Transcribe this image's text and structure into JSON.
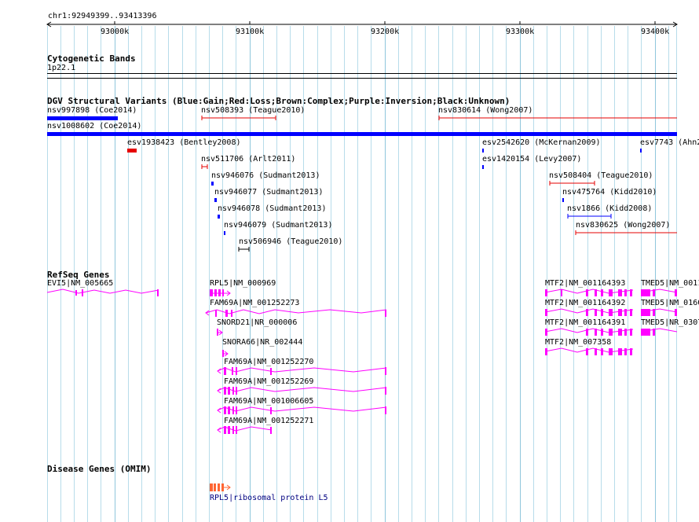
{
  "ruler": {
    "location": "chr1:92949399..93413396",
    "ticks": [
      "93000k",
      "93100k",
      "93200k",
      "93300k",
      "93400k"
    ]
  },
  "cytoband": {
    "title": "Cytogenetic Bands",
    "band": "1p22.1"
  },
  "dgv": {
    "title": "DGV Structural Variants (Blue:Gain;Red:Loss;Brown:Complex;Purple:Inversion;Black:Unknown)",
    "features": [
      {
        "label": "nsv997898 (Coe2014)",
        "color": "#0000ff"
      },
      {
        "label": "nsv508393 (Teague2010)",
        "color": "#e60000"
      },
      {
        "label": "nsv830614 (Wong2007)",
        "color": "#e60000"
      },
      {
        "label": "nsv1008602 (Coe2014)",
        "color": "#0000ff"
      },
      {
        "label": "esv1938423 (Bentley2008)",
        "color": "#e60000"
      },
      {
        "label": "esv2542620 (McKernan2009)",
        "color": "#0000ff"
      },
      {
        "label": "esv7743 (Ahn2",
        "color": "#0000ff"
      },
      {
        "label": "nsv511706 (Arlt2011)",
        "color": "#e60000"
      },
      {
        "label": "esv1420154 (Levy2007)",
        "color": "#0000ff"
      },
      {
        "label": "nsv946076 (Sudmant2013)",
        "color": "#0000ff"
      },
      {
        "label": "nsv508404 (Teague2010)",
        "color": "#e60000"
      },
      {
        "label": "nsv946077 (Sudmant2013)",
        "color": "#0000ff"
      },
      {
        "label": "nsv475764 (Kidd2010)",
        "color": "#0000ff"
      },
      {
        "label": "nsv946078 (Sudmant2013)",
        "color": "#0000ff"
      },
      {
        "label": "nsv1866 (Kidd2008)",
        "color": "#0000ff"
      },
      {
        "label": "nsv946079 (Sudmant2013)",
        "color": "#0000ff"
      },
      {
        "label": "nsv830625 (Wong2007)",
        "color": "#e60000"
      },
      {
        "label": "nsv506946 (Teague2010)",
        "color": "#000000"
      }
    ]
  },
  "refseq": {
    "title": "RefSeq Genes",
    "color": "#ff00ff",
    "genes": [
      "EVI5|NM_005665",
      "RPL5|NM_000969",
      "FAM69A|NM_001252273",
      "SNORD21|NR_000006",
      "SNORA66|NR_002444",
      "FAM69A|NM_001252270",
      "FAM69A|NM_001252269",
      "FAM69A|NM_001006605",
      "FAM69A|NM_001252271",
      "MTF2|NM_001164393",
      "MTF2|NM_001164392",
      "MTF2|NM_001164391",
      "MTF2|NM_007358",
      "TMED5|NM_0011",
      "TMED5|NM_0160",
      "TMED5|NR_0307"
    ]
  },
  "omim": {
    "title": "Disease Genes (OMIM)",
    "gene": "RPL5|ribosomal protein L5",
    "color": "#ff6633",
    "label_color": "#000080"
  }
}
